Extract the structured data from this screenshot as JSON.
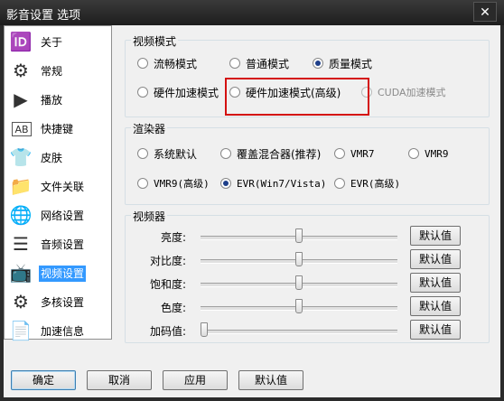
{
  "window": {
    "title": "影音设置 选项",
    "close_label": "✕"
  },
  "sidebar": {
    "items": [
      {
        "label": "关于",
        "icon": "🆔"
      },
      {
        "label": "常规",
        "icon": "⚙"
      },
      {
        "label": "播放",
        "icon": "▶"
      },
      {
        "label": "快捷键",
        "icon": "AB"
      },
      {
        "label": "皮肤",
        "icon": "👕"
      },
      {
        "label": "文件关联",
        "icon": "📁"
      },
      {
        "label": "网络设置",
        "icon": "🌐"
      },
      {
        "label": "音频设置",
        "icon": "☰"
      },
      {
        "label": "视频设置",
        "icon": "📺"
      },
      {
        "label": "多核设置",
        "icon": "⚙"
      },
      {
        "label": "加速信息",
        "icon": "📄"
      }
    ],
    "selected": "视频设置"
  },
  "video_mode": {
    "title": "视频模式",
    "options": [
      "流畅模式",
      "普通模式",
      "质量模式",
      "硬件加速模式",
      "硬件加速模式(高级)",
      "CUDA加速模式"
    ],
    "selected": "质量模式"
  },
  "renderer": {
    "title": "渲染器",
    "options": [
      "系统默认",
      "覆盖混合器(推荐)",
      "VMR7",
      "VMR9",
      "VMR9(高级)",
      "EVR(Win7/Vista)",
      "EVR(高级)"
    ],
    "selected": "EVR(Win7/Vista)"
  },
  "video_adjust": {
    "title": "视频器",
    "reset_label": "默认值",
    "sliders": [
      {
        "label": "亮度:",
        "value": 0.5
      },
      {
        "label": "对比度:",
        "value": 0.5
      },
      {
        "label": "饱和度:",
        "value": 0.5
      },
      {
        "label": "色度:",
        "value": 0.5
      },
      {
        "label": "加码值:",
        "value": 0.0
      }
    ]
  },
  "footer": {
    "ok": "确定",
    "cancel": "取消",
    "apply": "应用",
    "default": "默认值"
  }
}
